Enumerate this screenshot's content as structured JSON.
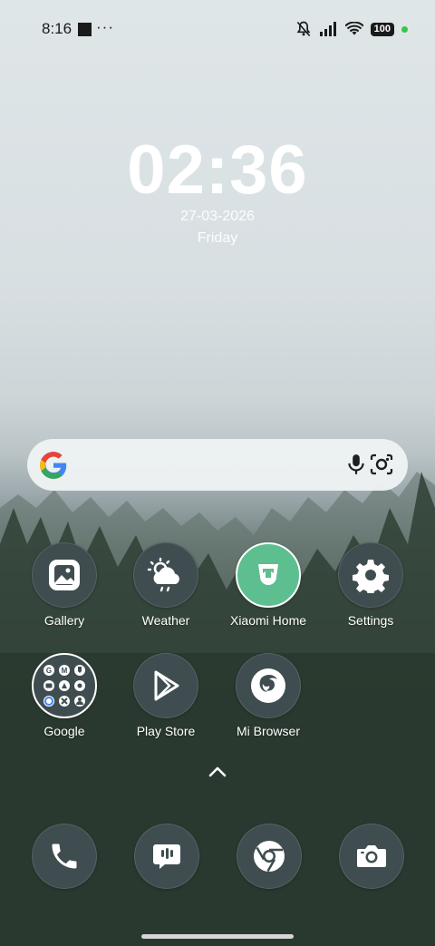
{
  "status_bar": {
    "time": "8:16",
    "overflow": "···",
    "battery": "100"
  },
  "lockclock": {
    "time": "02:36",
    "date": "27-03-2026",
    "day": "Friday"
  },
  "apps_row1": [
    {
      "label": "Gallery"
    },
    {
      "label": "Weather"
    },
    {
      "label": "Xiaomi Home"
    },
    {
      "label": "Settings"
    }
  ],
  "apps_row2": [
    {
      "label": "Google"
    },
    {
      "label": "Play Store"
    },
    {
      "label": "Mi Browser"
    }
  ],
  "dock": [
    "phone-icon",
    "messages-icon",
    "chrome-icon",
    "camera-icon"
  ],
  "colors": {
    "icon_bg": "#3f4d50",
    "xiaomi_green": "#5dbf8f",
    "status_dot": "#2ecc40"
  }
}
